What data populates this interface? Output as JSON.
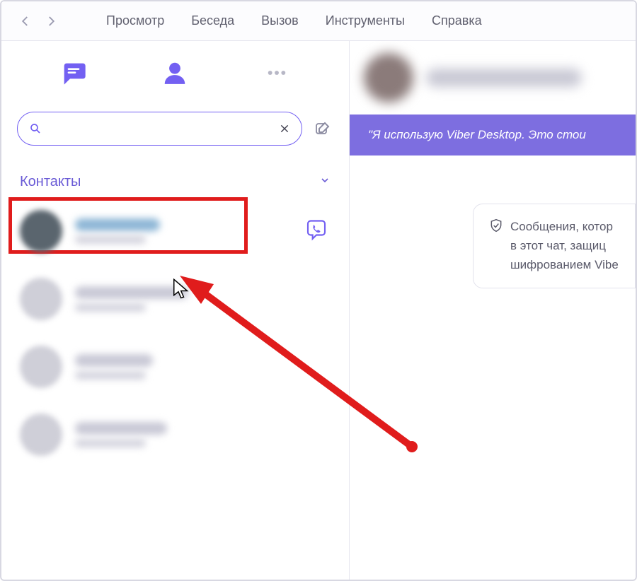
{
  "menubar": {
    "items": [
      "Просмотр",
      "Беседа",
      "Вызов",
      "Инструменты",
      "Справка"
    ]
  },
  "sidebar": {
    "section_title": "Контакты"
  },
  "search": {
    "placeholder": ""
  },
  "banner": {
    "text": "\"Я использую Viber Desktop. Это стои"
  },
  "encryption": {
    "line1": "Сообщения, котор",
    "line2": "в этот чат, защиц",
    "line3": "шифрованием Vibe"
  },
  "colors": {
    "accent": "#7360f2",
    "highlight": "#e01c1c"
  }
}
